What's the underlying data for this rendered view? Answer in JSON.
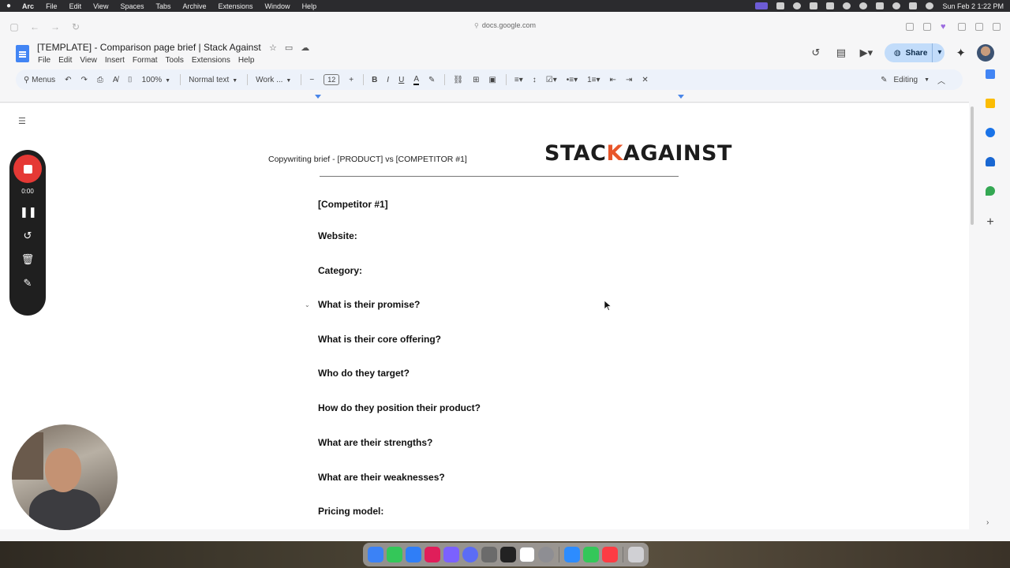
{
  "menubar": {
    "apple": "",
    "items": [
      "Arc",
      "File",
      "Edit",
      "View",
      "Spaces",
      "Tabs",
      "Archive",
      "Extensions",
      "Window",
      "Help"
    ],
    "clock": "Sun Feb 2  1:22 PM"
  },
  "browser": {
    "url": "docs.google.com"
  },
  "doc": {
    "title": "[TEMPLATE] - Comparison page brief | Stack Against",
    "menu": [
      "File",
      "Edit",
      "View",
      "Insert",
      "Format",
      "Tools",
      "Extensions",
      "Help"
    ],
    "share_label": "Share"
  },
  "toolbar": {
    "menus_label": "Menus",
    "zoom": "100%",
    "style": "Normal text",
    "font": "Work ...",
    "font_size": "12",
    "mode": "Editing"
  },
  "page": {
    "header_text": "Copywriting brief - [PRODUCT] vs [COMPETITOR #1]",
    "logo_left": "STAC",
    "logo_chevron": "K",
    "logo_right": "AGAINST",
    "headings": [
      "[Competitor #1]",
      "Website:",
      "Category:",
      "What is their promise?",
      "What is their core offering?",
      "Who do they target?",
      "How do they position their product?",
      "What are their strengths?",
      "What are their weaknesses?",
      "Pricing model:"
    ]
  },
  "recorder": {
    "time": "0:00"
  },
  "colors": {
    "accent": "#4285f4",
    "record": "#e53935",
    "logo_accent": "#e8562a",
    "toolbar_bg": "#edf2fa",
    "share_bg": "#c2dcfa"
  }
}
